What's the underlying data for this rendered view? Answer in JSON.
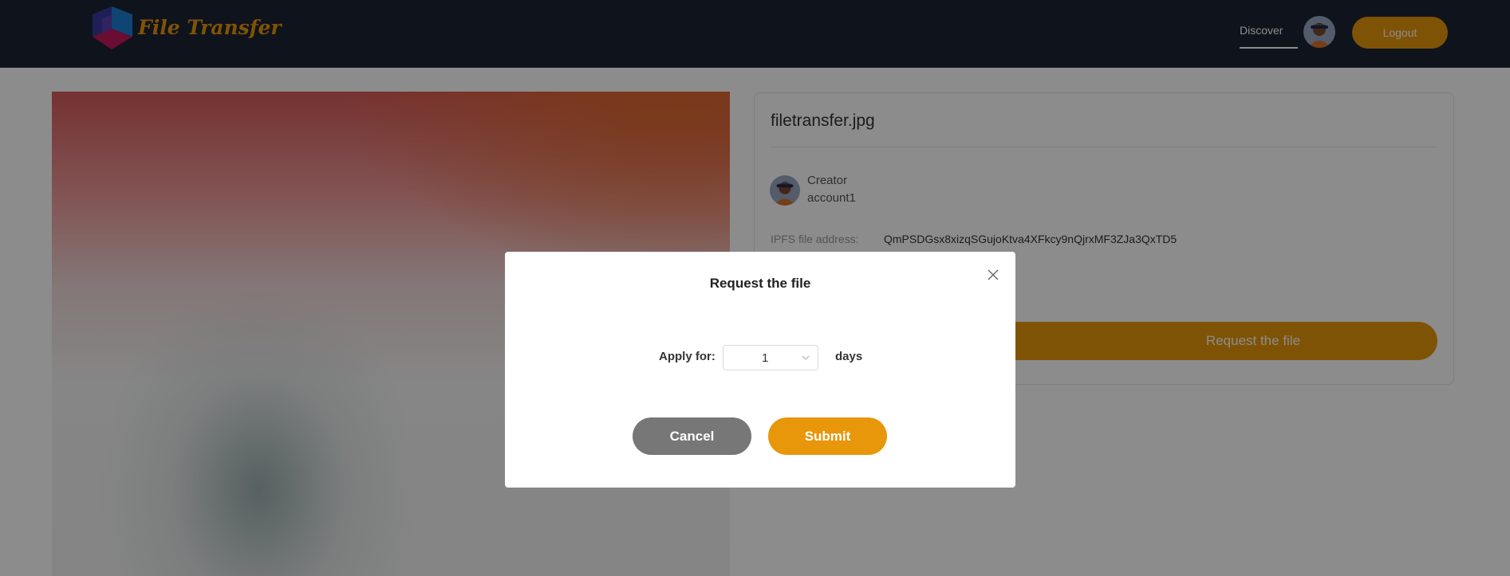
{
  "header": {
    "brand": "File Transfer",
    "nav_discover": "Discover",
    "logout_label": "Logout"
  },
  "file": {
    "name": "filetransfer.jpg",
    "creator_label": "Creator",
    "creator_name": "account1",
    "ipfs_label": "IPFS file address:",
    "ipfs_value": "QmPSDGsx8xizqSGujoKtva4XFkcy9nQjrxMF3ZJa3QxTD5",
    "request_label": "Request the file"
  },
  "modal": {
    "title": "Request the file",
    "apply_label": "Apply for:",
    "days_value": "1",
    "days_unit": "days",
    "cancel_label": "Cancel",
    "submit_label": "Submit"
  },
  "colors": {
    "header_bg": "#1c2433",
    "accent": "#e8970a",
    "cancel_bg": "#777777"
  }
}
